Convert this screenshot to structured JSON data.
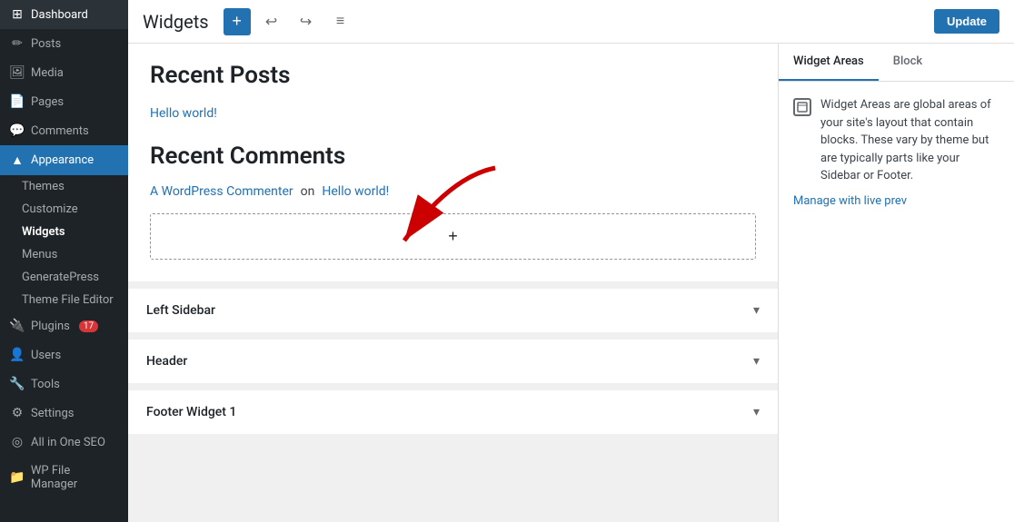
{
  "sidebar": {
    "items": [
      {
        "id": "dashboard",
        "label": "Dashboard",
        "icon": "⊞",
        "active": false
      },
      {
        "id": "posts",
        "label": "Posts",
        "icon": "📝",
        "active": false
      },
      {
        "id": "media",
        "label": "Media",
        "icon": "🖼",
        "active": false
      },
      {
        "id": "pages",
        "label": "Pages",
        "icon": "📄",
        "active": false
      },
      {
        "id": "comments",
        "label": "Comments",
        "icon": "💬",
        "active": false
      },
      {
        "id": "appearance",
        "label": "Appearance",
        "icon": "🎨",
        "active": true
      },
      {
        "id": "plugins",
        "label": "Plugins",
        "icon": "🔌",
        "active": false,
        "badge": "17"
      },
      {
        "id": "users",
        "label": "Users",
        "icon": "👤",
        "active": false
      },
      {
        "id": "tools",
        "label": "Tools",
        "icon": "🔧",
        "active": false
      },
      {
        "id": "settings",
        "label": "Settings",
        "icon": "⚙",
        "active": false
      },
      {
        "id": "all-in-one-seo",
        "label": "All in One SEO",
        "icon": "◎",
        "active": false
      },
      {
        "id": "wp-file-manager",
        "label": "WP File Manager",
        "icon": "📁",
        "active": false
      }
    ],
    "appearance_sub": [
      {
        "id": "themes",
        "label": "Themes",
        "active": false
      },
      {
        "id": "customize",
        "label": "Customize",
        "active": false
      },
      {
        "id": "widgets",
        "label": "Widgets",
        "active": true
      },
      {
        "id": "menus",
        "label": "Menus",
        "active": false
      },
      {
        "id": "generatepress",
        "label": "GeneratePress",
        "active": false
      },
      {
        "id": "theme-file-editor",
        "label": "Theme File Editor",
        "active": false
      }
    ]
  },
  "topbar": {
    "title": "Widgets",
    "add_label": "+",
    "update_label": "Update"
  },
  "main": {
    "recent_posts_title": "Recent Posts",
    "hello_world_link": "Hello world!",
    "recent_comments_title": "Recent Comments",
    "commenter_link": "A WordPress Commenter",
    "on_text": "on",
    "hello_world_link2": "Hello world!",
    "add_block_icon": "+",
    "sections": [
      {
        "id": "left-sidebar",
        "label": "Left Sidebar"
      },
      {
        "id": "header",
        "label": "Header"
      },
      {
        "id": "footer-widget-1",
        "label": "Footer Widget 1"
      }
    ]
  },
  "right_panel": {
    "tab_widget_areas": "Widget Areas",
    "tab_block": "Block",
    "info_text": "Widget Areas are global areas of your site's layout that contain blocks. These vary by theme but are typically parts like your Sidebar or Footer.",
    "manage_link": "Manage with live prev"
  }
}
